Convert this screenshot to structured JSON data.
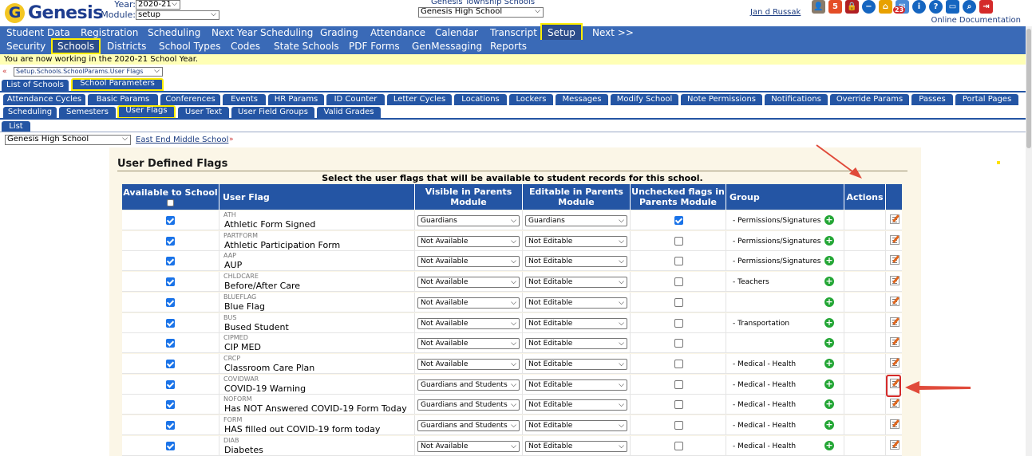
{
  "app": {
    "logo_letter": "G",
    "logo_text": "Genesis"
  },
  "header": {
    "year_label": "Year:",
    "year_value": "2020-21",
    "module_label": "Module:",
    "module_value": "setup",
    "district": "Genesis Township Schools",
    "school": "Genesis High School",
    "user": "Jan d Russak",
    "online_doc": "Online Documentation",
    "badge_count": "23"
  },
  "menu_main": [
    "Student Data",
    "Registration",
    "Scheduling",
    "Next Year Scheduling",
    "Grading",
    "Attendance",
    "Calendar",
    "Transcript",
    "Setup",
    "Next >>"
  ],
  "menu_sub": [
    "Security",
    "Schools",
    "Districts",
    "School Types",
    "Codes",
    "State Schools",
    "PDF Forms",
    "GenMessaging",
    "Reports"
  ],
  "notice": "You are now working in the 2020-21 School Year.",
  "breadcrumb": "Setup.Schools.SchoolParams.User Flags",
  "tabs_level1": [
    "List of Schools",
    "School Parameters"
  ],
  "tabs_level2_row1": [
    "Attendance Cycles",
    "Basic Params",
    "Conferences",
    "Events",
    "HR Params",
    "ID Counter",
    "Letter Cycles",
    "Locations",
    "Lockers",
    "Messages",
    "Modify School",
    "Note Permissions",
    "Notifications",
    "Override Params",
    "Passes",
    "Portal Pages"
  ],
  "tabs_level2_row2": [
    "Scheduling",
    "Semesters",
    "User Flags",
    "User Text",
    "User Field Groups",
    "Valid Grades"
  ],
  "tabs_level3": [
    "List"
  ],
  "school_select": "Genesis High School",
  "school_link": "East End Middle School",
  "panel": {
    "title": "User Defined Flags",
    "subtitle": "Select the user flags that will be available to student records for this school."
  },
  "table": {
    "headers": [
      "Available to School",
      "User Flag",
      "Visible in Parents Module",
      "Editable in Parents Module",
      "Unchecked flags in Parents Module",
      "Group",
      "Actions"
    ],
    "rows": [
      {
        "code": "ATH",
        "name": "Athletic Form Signed",
        "visible": "Guardians",
        "editable": "Guardians",
        "unchecked": true,
        "group": "- Permissions/Signatures"
      },
      {
        "code": "PARTFORM",
        "name": "Athletic Participation Form",
        "visible": "Not Available",
        "editable": "Not Editable",
        "unchecked": false,
        "group": "- Permissions/Signatures"
      },
      {
        "code": "AAP",
        "name": "AUP",
        "visible": "Not Available",
        "editable": "Not Editable",
        "unchecked": false,
        "group": "- Permissions/Signatures"
      },
      {
        "code": "CHLDCARE",
        "name": "Before/After Care",
        "visible": "Not Available",
        "editable": "Not Editable",
        "unchecked": false,
        "group": "- Teachers"
      },
      {
        "code": "BLUEFLAG",
        "name": "Blue Flag",
        "visible": "Not Available",
        "editable": "Not Editable",
        "unchecked": false,
        "group": ""
      },
      {
        "code": "BUS",
        "name": "Bused Student",
        "visible": "Not Available",
        "editable": "Not Editable",
        "unchecked": false,
        "group": "- Transportation"
      },
      {
        "code": "CIPMED",
        "name": "CIP MED",
        "visible": "Not Available",
        "editable": "Not Editable",
        "unchecked": false,
        "group": ""
      },
      {
        "code": "CRCP",
        "name": "Classroom Care Plan",
        "visible": "Not Available",
        "editable": "Not Editable",
        "unchecked": false,
        "group": "- Medical - Health"
      },
      {
        "code": "COVIDWAR",
        "name": "COVID-19 Warning",
        "visible": "Guardians and Students",
        "editable": "Not Editable",
        "unchecked": false,
        "group": "- Medical - Health"
      },
      {
        "code": "NOFORM",
        "name": "Has NOT Answered COVID-19 Form Today",
        "visible": "Guardians and Students",
        "editable": "Not Editable",
        "unchecked": false,
        "group": "- Medical - Health"
      },
      {
        "code": "FORM",
        "name": "HAS filled out COVID-19 form today",
        "visible": "Guardians and Students",
        "editable": "Not Editable",
        "unchecked": false,
        "group": "- Medical - Health"
      },
      {
        "code": "DIAB",
        "name": "Diabetes",
        "visible": "Not Available",
        "editable": "Not Editable",
        "unchecked": false,
        "group": "- Medical - Health"
      }
    ]
  },
  "colors": {
    "nav_blue": "#3a6ab7",
    "tab_blue": "#2455a4",
    "highlight": "#ffee00",
    "annotation_red": "#d42a2a",
    "plus_green": "#23a635"
  }
}
